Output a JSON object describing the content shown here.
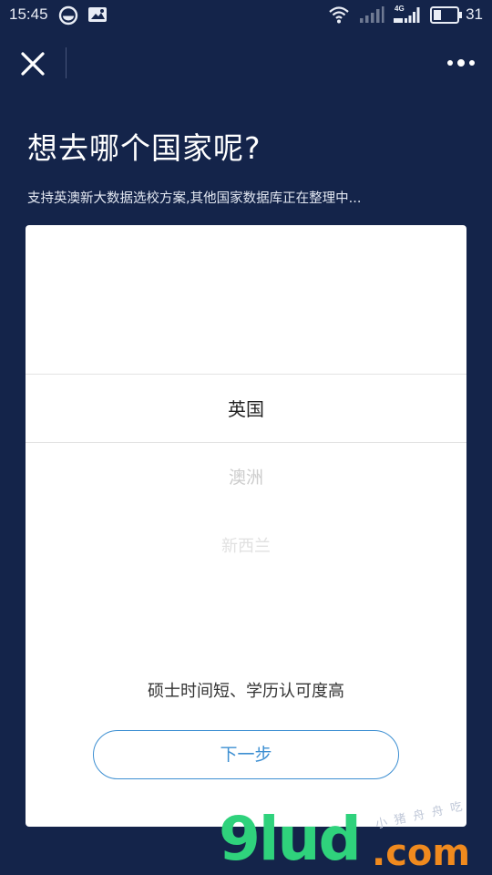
{
  "status_bar": {
    "time": "15:45",
    "network": "4G",
    "battery": "31",
    "icons": [
      "browser-icon",
      "photo-notification-icon",
      "wifi-icon",
      "signal-icon",
      "signal-4g-icon",
      "battery-icon"
    ]
  },
  "nav": {
    "close_icon": "close-icon",
    "more_icon": "more-dots-icon"
  },
  "header": {
    "title": "想去哪个国家呢?",
    "subtitle": "支持英澳新大数据选校方案,其他国家数据库正在整理中..."
  },
  "picker": {
    "selected": "英国",
    "options": [
      "英国",
      "澳洲",
      "新西兰"
    ]
  },
  "description": "硕士时间短、学历认可度高",
  "next_button": "下一步",
  "watermark": {
    "main": "9lud",
    "suffix": ".com",
    "small": "小猪舟舟吃"
  },
  "colors": {
    "background": "#14244a",
    "card": "#ffffff",
    "accent": "#3d8fd2",
    "watermark_green": "#2fd27c",
    "watermark_orange": "#f08a1e"
  }
}
